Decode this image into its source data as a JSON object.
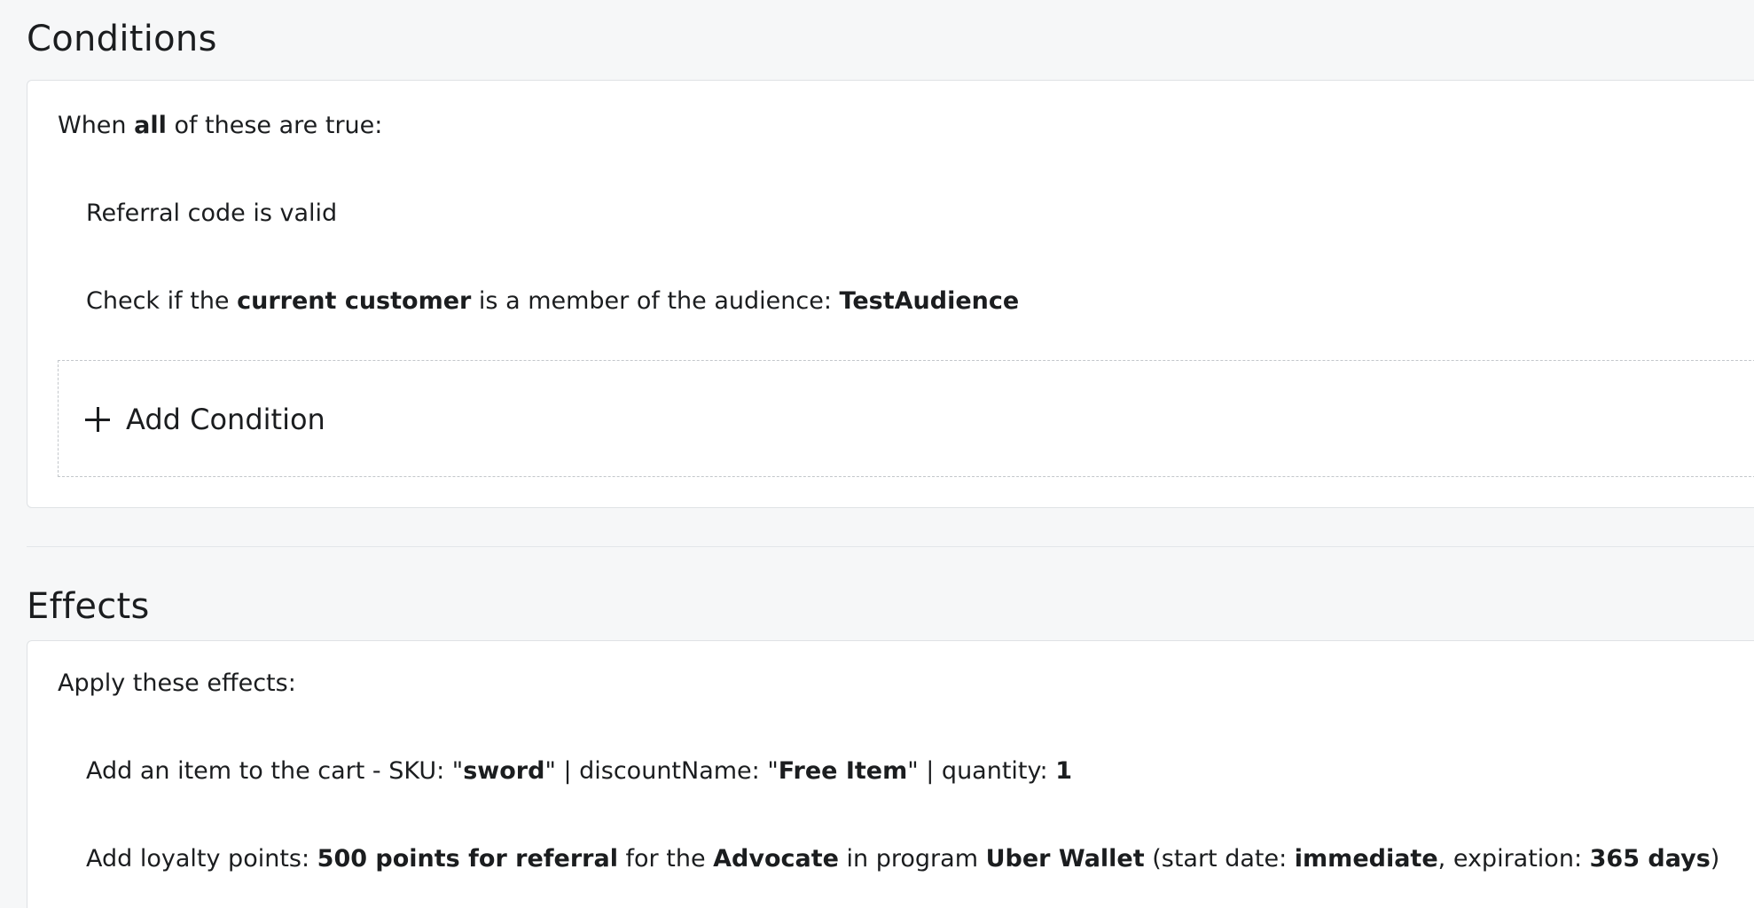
{
  "conditions": {
    "title": "Conditions",
    "intro": {
      "pre": "When ",
      "bold": "all",
      "post": " of these are true:"
    },
    "items": [
      {
        "text": "Referral code is valid"
      },
      {
        "pre": "Check if the ",
        "bold1": "current customer",
        "mid": " is a member of the audience: ",
        "bold2": "TestAudience"
      }
    ],
    "add_label": "Add Condition",
    "add_icon": "plus-icon"
  },
  "effects": {
    "title": "Effects",
    "intro": "Apply these effects:",
    "items": [
      {
        "p1": "Add an item to the cart - SKU: \"",
        "b1": "sword",
        "p2": "\" | discountName: \"",
        "b2": "Free Item",
        "p3": "\" | quantity: ",
        "b3": "1"
      },
      {
        "p1": "Add loyalty points: ",
        "b1": "500 points for referral",
        "p2": " for the ",
        "b2": "Advocate",
        "p3": " in program ",
        "b3": "Uber Wallet",
        "p4": " (start date: ",
        "b4": "immediate",
        "p5": ", expiration: ",
        "b5": "365 days",
        "p6": ")"
      }
    ]
  }
}
